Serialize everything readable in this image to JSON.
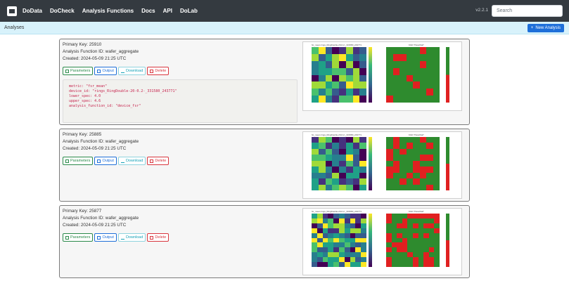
{
  "nav": {
    "items": [
      "DoData",
      "DoCheck",
      "Analysis Functions",
      "Docs",
      "API",
      "DoLab"
    ],
    "version": "v2.2.1",
    "search_placeholder": "Search"
  },
  "subbar": {
    "title": "Analyses",
    "new_button": "New Analysis"
  },
  "buttons": {
    "parameters": "Parameters",
    "output": "Output",
    "download": "Download",
    "delete": "Delete"
  },
  "cards": [
    {
      "primary_key": "Primary Key: 25910",
      "function_id": "Analysis Function ID: wafer_aggregate",
      "created": "Created: 2024-05-09 21:25 UTC",
      "params": [
        "metric: \"fsr_mean\"",
        "device_id: \"rings_RingDouble-20-0.2-_331580_243771\"",
        "lower_spec: 4.0",
        "upper_spec: 4.6",
        "analysis_function_id: \"device_fsr\""
      ],
      "figure_title_left": "fsr_mean rings_RingDouble-20-0.2-_331580_243771",
      "figure_title_right": "KGD \"Pass/Fail\"",
      "left_rows": 8,
      "left_cols": 8,
      "right_pattern": [
        "pass",
        "pass",
        "pass",
        "pass",
        "fail",
        "fail",
        "fail",
        "fail"
      ]
    },
    {
      "primary_key": "Primary Key: 25885",
      "function_id": "Analysis Function ID: wafer_aggregate",
      "created": "Created: 2024-05-09 21:25 UTC",
      "figure_title_left": "fsr_mean rings_RingDouble-20-0.2-_331580_243771",
      "figure_title_right": "KGD \"Pass/Fail\"",
      "left_rows": 9,
      "left_cols": 8
    },
    {
      "primary_key": "Primary Key: 25877",
      "function_id": "Analysis Function ID: wafer_aggregate",
      "created": "Created: 2024-05-09 21:25 UTC",
      "figure_title_left": "fsr_mean rings_RingDouble-20-0.2-_331580_243771",
      "figure_title_right": "KGD \"Pass/Fail\"",
      "left_rows": 11,
      "left_cols": 10
    }
  ],
  "colors": {
    "nav_bg": "#343a40",
    "subbar_bg": "#d8f2fb",
    "primary": "#1e6fd9",
    "pass": "#2e8b2e",
    "fail": "#e02020"
  }
}
